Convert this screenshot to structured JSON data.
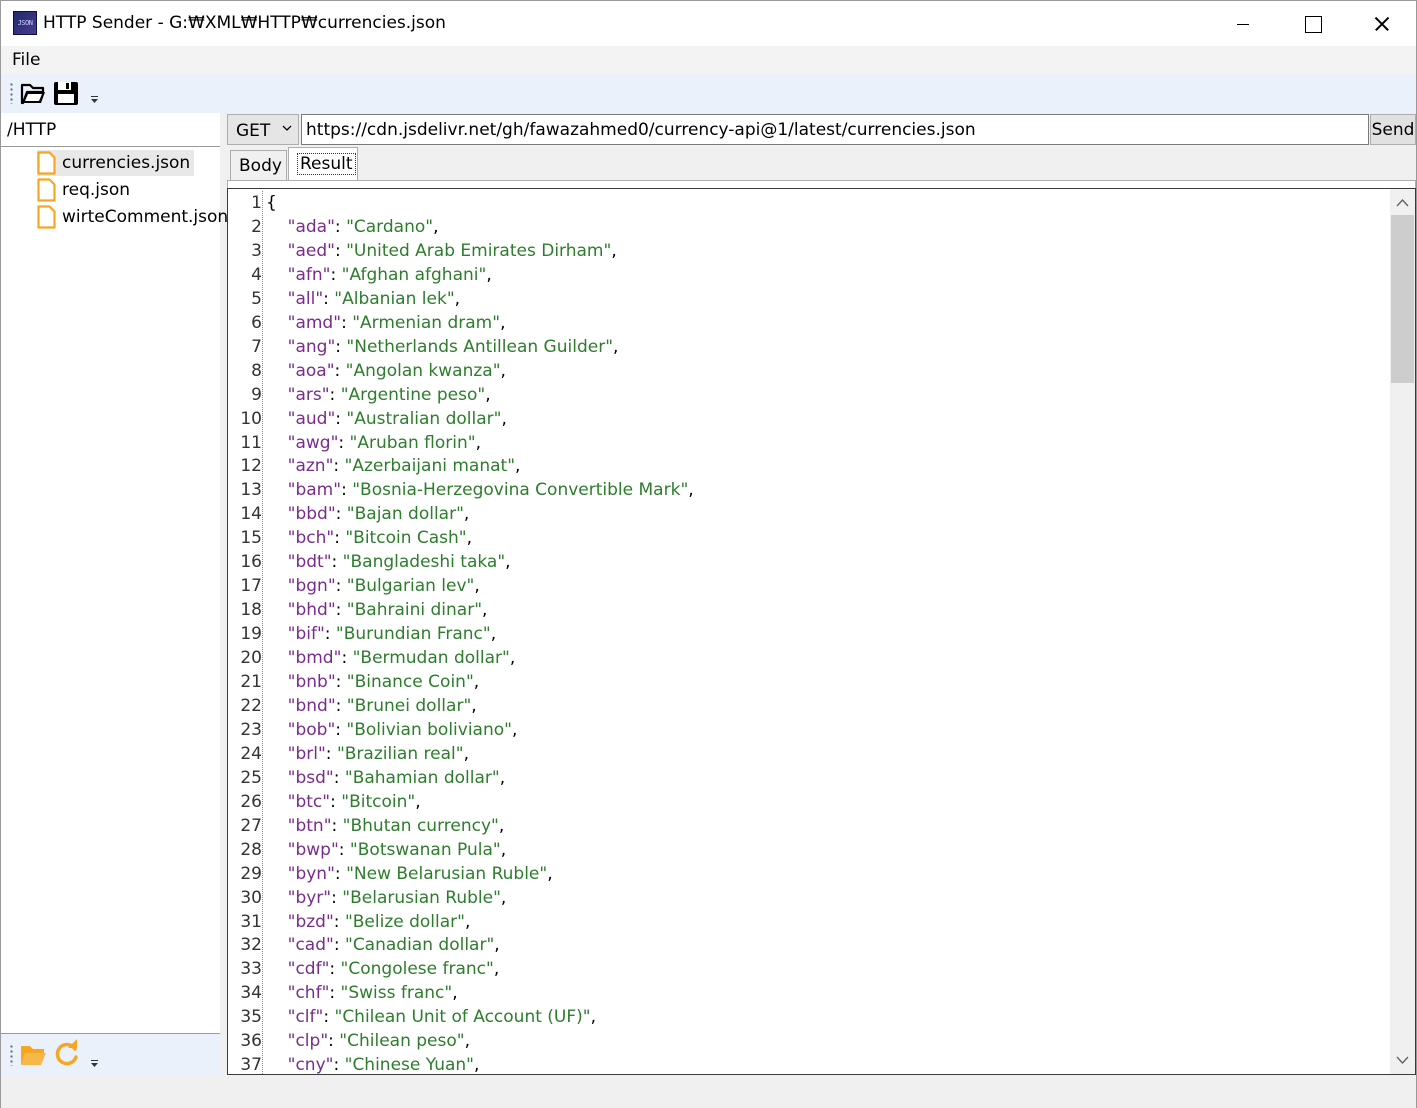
{
  "window": {
    "title": "HTTP Sender - G:₩XML₩HTTP₩currencies.json",
    "app_icon_text": "JSON"
  },
  "menu": {
    "file": "File"
  },
  "toolbar": {
    "icons": [
      "open-folder-icon",
      "save-icon"
    ]
  },
  "left_panel": {
    "path": "/HTTP",
    "files": [
      {
        "name": "currencies.json",
        "selected": true
      },
      {
        "name": "req.json",
        "selected": false
      },
      {
        "name": "wirteComment.json",
        "selected": false
      }
    ],
    "bottom_icons": [
      "folder-icon",
      "refresh-icon"
    ]
  },
  "request": {
    "method": "GET",
    "url": "https://cdn.jsdelivr.net/gh/fawazahmed0/currency-api@1/latest/currencies.json",
    "send_label": "Send"
  },
  "tabs": [
    {
      "label": "Body",
      "active": false
    },
    {
      "label": "Result",
      "active": true
    }
  ],
  "colors": {
    "json_key": "#7a2c8c",
    "json_string": "#2d7d2d",
    "selection": "#e8e8e8",
    "file_icon": "#f5a623",
    "toolbar_bg": "#eaf1fb"
  },
  "editor": {
    "lines": [
      {
        "n": "1",
        "open": "{"
      },
      {
        "n": "2",
        "key": "ada",
        "value": "Cardano"
      },
      {
        "n": "3",
        "key": "aed",
        "value": "United Arab Emirates Dirham"
      },
      {
        "n": "4",
        "key": "afn",
        "value": "Afghan afghani"
      },
      {
        "n": "5",
        "key": "all",
        "value": "Albanian lek"
      },
      {
        "n": "6",
        "key": "amd",
        "value": "Armenian dram"
      },
      {
        "n": "7",
        "key": "ang",
        "value": "Netherlands Antillean Guilder"
      },
      {
        "n": "8",
        "key": "aoa",
        "value": "Angolan kwanza"
      },
      {
        "n": "9",
        "key": "ars",
        "value": "Argentine peso"
      },
      {
        "n": "10",
        "key": "aud",
        "value": "Australian dollar"
      },
      {
        "n": "11",
        "key": "awg",
        "value": "Aruban florin"
      },
      {
        "n": "12",
        "key": "azn",
        "value": "Azerbaijani manat"
      },
      {
        "n": "13",
        "key": "bam",
        "value": "Bosnia-Herzegovina Convertible Mark"
      },
      {
        "n": "14",
        "key": "bbd",
        "value": "Bajan dollar"
      },
      {
        "n": "15",
        "key": "bch",
        "value": "Bitcoin Cash"
      },
      {
        "n": "16",
        "key": "bdt",
        "value": "Bangladeshi taka"
      },
      {
        "n": "17",
        "key": "bgn",
        "value": "Bulgarian lev"
      },
      {
        "n": "18",
        "key": "bhd",
        "value": "Bahraini dinar"
      },
      {
        "n": "19",
        "key": "bif",
        "value": "Burundian Franc"
      },
      {
        "n": "20",
        "key": "bmd",
        "value": "Bermudan dollar"
      },
      {
        "n": "21",
        "key": "bnb",
        "value": "Binance Coin"
      },
      {
        "n": "22",
        "key": "bnd",
        "value": "Brunei dollar"
      },
      {
        "n": "23",
        "key": "bob",
        "value": "Bolivian boliviano"
      },
      {
        "n": "24",
        "key": "brl",
        "value": "Brazilian real"
      },
      {
        "n": "25",
        "key": "bsd",
        "value": "Bahamian dollar"
      },
      {
        "n": "26",
        "key": "btc",
        "value": "Bitcoin"
      },
      {
        "n": "27",
        "key": "btn",
        "value": "Bhutan currency"
      },
      {
        "n": "28",
        "key": "bwp",
        "value": "Botswanan Pula"
      },
      {
        "n": "29",
        "key": "byn",
        "value": "New Belarusian Ruble"
      },
      {
        "n": "30",
        "key": "byr",
        "value": "Belarusian Ruble"
      },
      {
        "n": "31",
        "key": "bzd",
        "value": "Belize dollar"
      },
      {
        "n": "32",
        "key": "cad",
        "value": "Canadian dollar"
      },
      {
        "n": "33",
        "key": "cdf",
        "value": "Congolese franc"
      },
      {
        "n": "34",
        "key": "chf",
        "value": "Swiss franc"
      },
      {
        "n": "35",
        "key": "clf",
        "value": "Chilean Unit of Account (UF)"
      },
      {
        "n": "36",
        "key": "clp",
        "value": "Chilean peso"
      },
      {
        "n": "37",
        "key": "cny",
        "value": "Chinese Yuan"
      }
    ],
    "scroll_position": 0.0
  }
}
